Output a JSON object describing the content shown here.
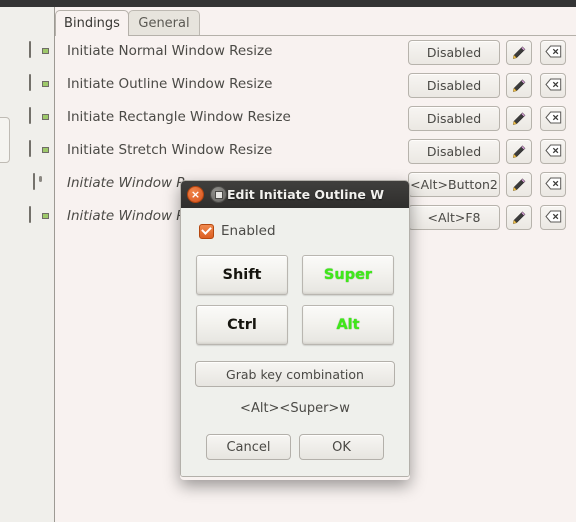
{
  "window": {
    "tabs": [
      {
        "label": "Bindings",
        "active": true
      },
      {
        "label": "General",
        "active": false
      }
    ]
  },
  "bindings": {
    "rows": [
      {
        "icon": "keyboard-icon",
        "label": "Initiate Normal Window Resize",
        "value": "Disabled",
        "modified": false
      },
      {
        "icon": "keyboard-icon",
        "label": "Initiate Outline Window Resize",
        "value": "Disabled",
        "modified": false
      },
      {
        "icon": "keyboard-icon",
        "label": "Initiate Rectangle Window Resize",
        "value": "Disabled",
        "modified": false
      },
      {
        "icon": "keyboard-icon",
        "label": "Initiate Stretch Window Resize",
        "value": "Disabled",
        "modified": false
      },
      {
        "icon": "mouse-icon",
        "label": "Initiate Window R",
        "value": "<Alt>Button2",
        "modified": true
      },
      {
        "icon": "keyboard-icon",
        "label": "Initiate Window R",
        "value": "<Alt>F8",
        "modified": true
      }
    ],
    "edit_icon": "pencil-icon",
    "clear_icon": "backspace-clear-icon"
  },
  "dialog": {
    "title": "Edit Initiate Outline W",
    "close_icon": "close-icon",
    "maximize_icon": "maximize-icon",
    "enabled_label": "Enabled",
    "enabled_checked": true,
    "modifiers": [
      {
        "label": "Shift",
        "active": false
      },
      {
        "label": "Super",
        "active": true
      },
      {
        "label": "Ctrl",
        "active": false
      },
      {
        "label": "Alt",
        "active": true
      }
    ],
    "grab_label": "Grab key combination",
    "combination": "<Alt><Super>w",
    "cancel_label": "Cancel",
    "ok_label": "OK"
  },
  "colors": {
    "background": "#f7f2f0",
    "dialog_bg": "#eff0ec",
    "titlebar": "#343434",
    "accent_orange": "#dc5f22",
    "active_modifier_green": "#3fe81a"
  }
}
